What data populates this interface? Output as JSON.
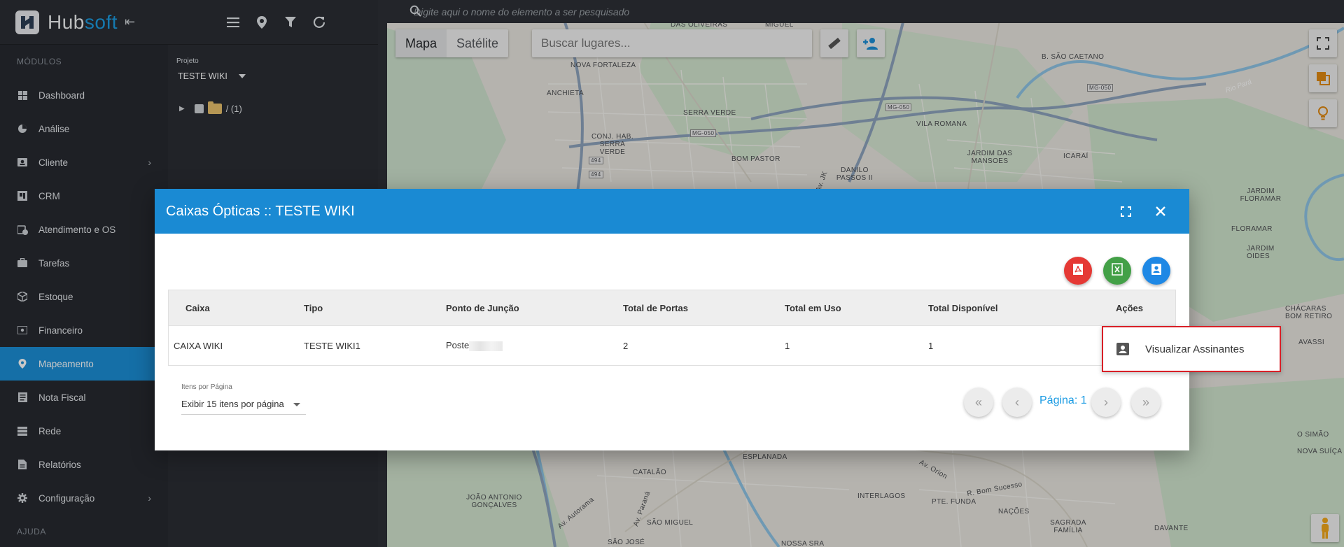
{
  "sidebar": {
    "brand": "Hubsoft",
    "section_modules": "MÓDULOS",
    "section_help": "AJUDA",
    "items": [
      {
        "label": "Dashboard",
        "icon": "dashboard-icon"
      },
      {
        "label": "Análise",
        "icon": "pie-chart-icon"
      },
      {
        "label": "Cliente",
        "icon": "contact-card-icon"
      },
      {
        "label": "CRM",
        "icon": "crm-icon"
      },
      {
        "label": "Atendimento e OS",
        "icon": "calendar-clock-icon"
      },
      {
        "label": "Tarefas",
        "icon": "briefcase-icon"
      },
      {
        "label": "Estoque",
        "icon": "box-icon"
      },
      {
        "label": "Financeiro",
        "icon": "money-icon"
      },
      {
        "label": "Mapeamento",
        "icon": "map-marker-icon",
        "active": true
      },
      {
        "label": "Nota Fiscal",
        "icon": "receipt-icon"
      },
      {
        "label": "Rede",
        "icon": "server-icon"
      },
      {
        "label": "Relatórios",
        "icon": "report-icon"
      },
      {
        "label": "Configuração",
        "icon": "gear-icon"
      }
    ]
  },
  "panel": {
    "project_label": "Projeto",
    "project_value": "TESTE WIKI",
    "tree_item": "/ (1)"
  },
  "map": {
    "search_placeholder": "Digite aqui o nome do elemento a ser pesquisado",
    "type_map": "Mapa",
    "type_satellite": "Satélite",
    "places_placeholder": "Buscar lugares...",
    "labels": [
      "DAS OLIVEIRAS",
      "MIGUEL",
      "SÃO CAETANO",
      "NOVA FORTALEZA",
      "B. SÃO CAETANO",
      "ANCHIETA",
      "MG-050",
      "Rio Pará",
      "SERRA VERDE",
      "MG-050",
      "VILA ROMANA",
      "CONJ. HAB. SERRA VERDE",
      "MG-050",
      "BOM PASTOR",
      "JARDIM DAS MANSOES",
      "ICARAÍ",
      "494",
      "DANILO PASSOS II",
      "494",
      "JARDIM FLORAMAR",
      "FLORAMAR",
      "JARDIM OIDES",
      "CHÁCARAS BOM RETIRO",
      "AVASSI",
      "O SIMÃO",
      "NOVA SUÍÇA",
      "CATALÃO",
      "ESPLANADA",
      "JOÃO ANTONIO GONÇALVES",
      "INTERLAGOS",
      "PTE. FUNDA",
      "R. Bom Sucesso",
      "NAÇÕES",
      "SAGRADA FAMÍLIA",
      "DAVANTE",
      "SÃO MIGUEL",
      "SÃO JOSÉ",
      "NOSSA SRA",
      "Av. Orion",
      "Av. Autorama",
      "Av. Paraná",
      "Av. JK"
    ]
  },
  "modal": {
    "title": "Caixas Ópticas :: TESTE WIKI",
    "columns": [
      "Caixa",
      "Tipo",
      "Ponto de Junção",
      "Total de Portas",
      "Total em Uso",
      "Total Disponível",
      "Ações"
    ],
    "rows": [
      {
        "caixa": "CAIXA WIKI",
        "tipo": "TESTE WIKI1",
        "ponto": "Poste",
        "portas": "2",
        "uso": "1",
        "disponivel": "1"
      }
    ],
    "per_page_label": "Itens por Página",
    "per_page_value": "Exibir 15 itens por página",
    "page_text": "Página: 1"
  },
  "context_menu": {
    "item": "Visualizar Assinantes"
  },
  "colors": {
    "accent": "#1a8ad3",
    "sidebar_bg": "#272a30",
    "pdf": "#e53935",
    "excel": "#43a047",
    "contacts": "#1e88e5",
    "highlight_border": "#d81f26"
  }
}
